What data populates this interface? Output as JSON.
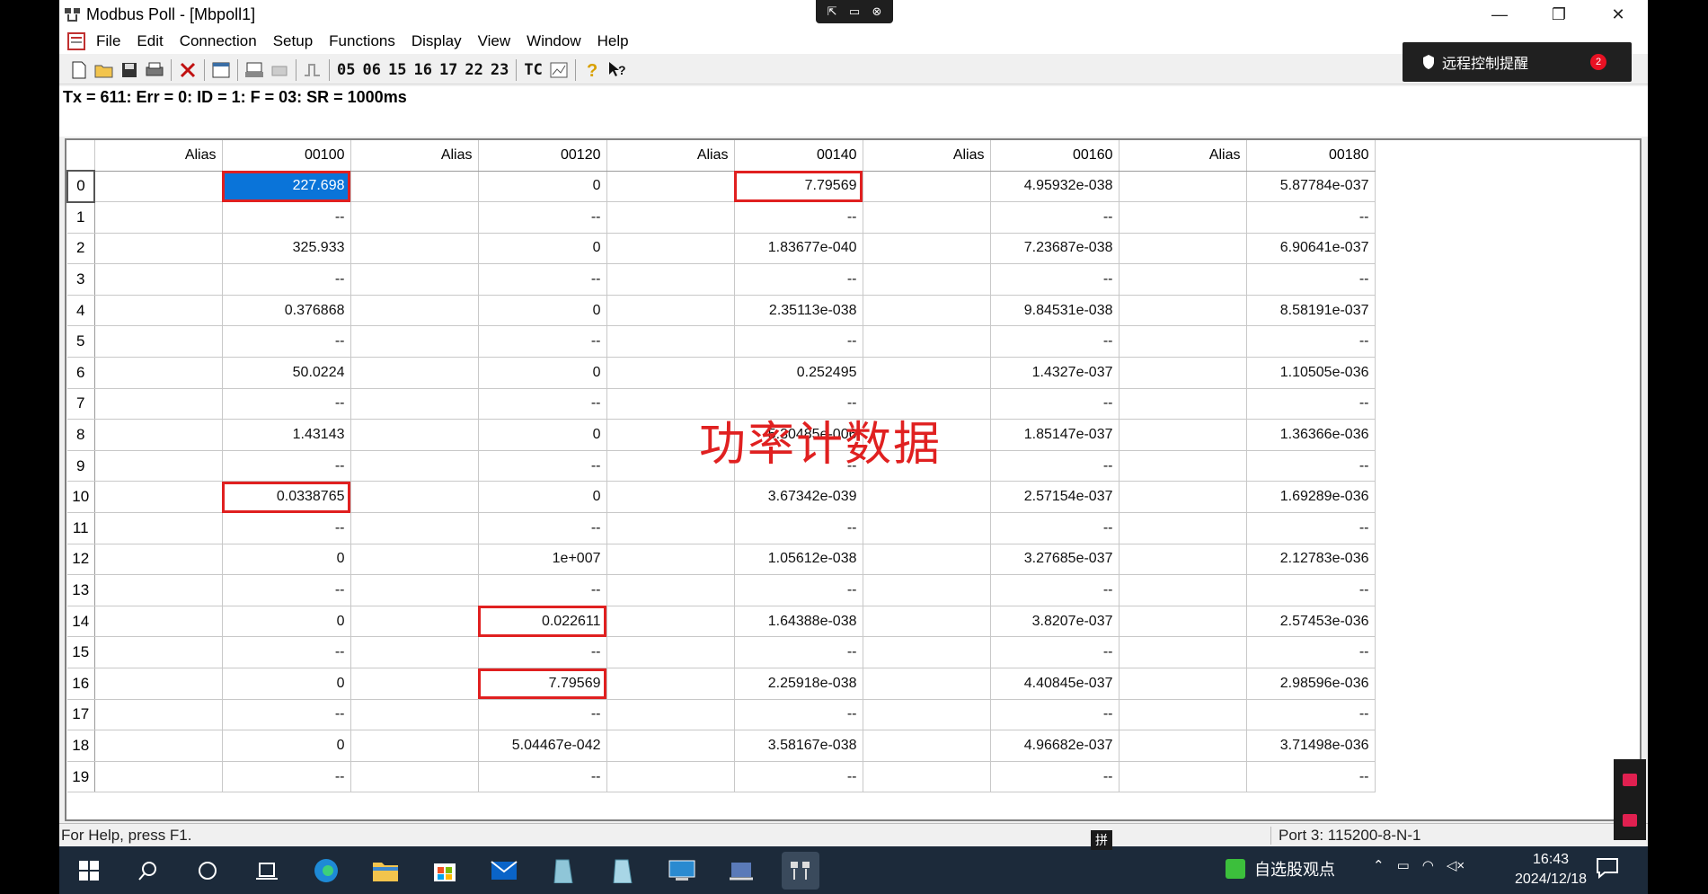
{
  "window": {
    "title": "Modbus Poll - [Mbpoll1]",
    "minimize": "—",
    "restore": "❐",
    "close": "✕"
  },
  "menu": [
    "File",
    "Edit",
    "Connection",
    "Setup",
    "Functions",
    "Display",
    "View",
    "Window",
    "Help"
  ],
  "toolbar": {
    "codes": [
      "05",
      "06",
      "15",
      "16",
      "17",
      "22",
      "23"
    ],
    "tc_label": "TC"
  },
  "notification": {
    "text": "远程控制提醒",
    "count": "2"
  },
  "status_line": "Tx = 611: Err = 0: ID = 1: F = 03: SR = 1000ms",
  "grid": {
    "headers": [
      "Alias",
      "00100",
      "Alias",
      "00120",
      "Alias",
      "00140",
      "Alias",
      "00160",
      "Alias",
      "00180"
    ],
    "rows": [
      {
        "n": "0",
        "cells": [
          "",
          "227.698",
          "",
          "0",
          "",
          "7.79569",
          "",
          "4.95932e-038",
          "",
          "5.87784e-037"
        ]
      },
      {
        "n": "1",
        "cells": [
          "",
          "--",
          "",
          "--",
          "",
          "--",
          "",
          "--",
          "",
          "--"
        ]
      },
      {
        "n": "2",
        "cells": [
          "",
          "325.933",
          "",
          "0",
          "",
          "1.83677e-040",
          "",
          "7.23687e-038",
          "",
          "6.90641e-037"
        ]
      },
      {
        "n": "3",
        "cells": [
          "",
          "--",
          "",
          "--",
          "",
          "--",
          "",
          "--",
          "",
          "--"
        ]
      },
      {
        "n": "4",
        "cells": [
          "",
          "0.376868",
          "",
          "0",
          "",
          "2.35113e-038",
          "",
          "9.84531e-038",
          "",
          "8.58191e-037"
        ]
      },
      {
        "n": "5",
        "cells": [
          "",
          "--",
          "",
          "--",
          "",
          "--",
          "",
          "--",
          "",
          "--"
        ]
      },
      {
        "n": "6",
        "cells": [
          "",
          "50.0224",
          "",
          "0",
          "",
          "0.252495",
          "",
          "1.4327e-037",
          "",
          "1.10505e-036"
        ]
      },
      {
        "n": "7",
        "cells": [
          "",
          "--",
          "",
          "--",
          "",
          "--",
          "",
          "--",
          "",
          "--"
        ]
      },
      {
        "n": "8",
        "cells": [
          "",
          "1.43143",
          "",
          "0",
          "",
          "5.30485e-006",
          "",
          "1.85147e-037",
          "",
          "1.36366e-036"
        ]
      },
      {
        "n": "9",
        "cells": [
          "",
          "--",
          "",
          "--",
          "",
          "--",
          "",
          "--",
          "",
          "--"
        ]
      },
      {
        "n": "10",
        "cells": [
          "",
          "0.0338765",
          "",
          "0",
          "",
          "3.67342e-039",
          "",
          "2.57154e-037",
          "",
          "1.69289e-036"
        ]
      },
      {
        "n": "11",
        "cells": [
          "",
          "--",
          "",
          "--",
          "",
          "--",
          "",
          "--",
          "",
          "--"
        ]
      },
      {
        "n": "12",
        "cells": [
          "",
          "0",
          "",
          "1e+007",
          "",
          "1.05612e-038",
          "",
          "3.27685e-037",
          "",
          "2.12783e-036"
        ]
      },
      {
        "n": "13",
        "cells": [
          "",
          "--",
          "",
          "--",
          "",
          "--",
          "",
          "--",
          "",
          "--"
        ]
      },
      {
        "n": "14",
        "cells": [
          "",
          "0",
          "",
          "0.022611",
          "",
          "1.64388e-038",
          "",
          "3.8207e-037",
          "",
          "2.57453e-036"
        ]
      },
      {
        "n": "15",
        "cells": [
          "",
          "--",
          "",
          "--",
          "",
          "--",
          "",
          "--",
          "",
          "--"
        ]
      },
      {
        "n": "16",
        "cells": [
          "",
          "0",
          "",
          "7.79569",
          "",
          "2.25918e-038",
          "",
          "4.40845e-037",
          "",
          "2.98596e-036"
        ]
      },
      {
        "n": "17",
        "cells": [
          "",
          "--",
          "",
          "--",
          "",
          "--",
          "",
          "--",
          "",
          "--"
        ]
      },
      {
        "n": "18",
        "cells": [
          "",
          "0",
          "",
          "5.04467e-042",
          "",
          "3.58167e-038",
          "",
          "4.96682e-037",
          "",
          "3.71498e-036"
        ]
      },
      {
        "n": "19",
        "cells": [
          "",
          "--",
          "",
          "--",
          "",
          "--",
          "",
          "--",
          "",
          "--"
        ]
      }
    ],
    "highlighted": [
      [
        0,
        1
      ],
      [
        0,
        5
      ],
      [
        10,
        1
      ],
      [
        14,
        3
      ],
      [
        16,
        3
      ]
    ],
    "selected": [
      0,
      1
    ]
  },
  "caption": "功率计数据",
  "statusbar": {
    "help": "For Help, press F1.",
    "port": "Port 3: 115200-8-N-1"
  },
  "taskbar": {
    "ime": "拼",
    "stock_label": "自选股观点",
    "time": "16:43",
    "date": "2024/12/18"
  },
  "colors": {
    "highlight_border": "#e02020",
    "selection": "#0a74d9",
    "taskbar": "#1c2a3a"
  }
}
